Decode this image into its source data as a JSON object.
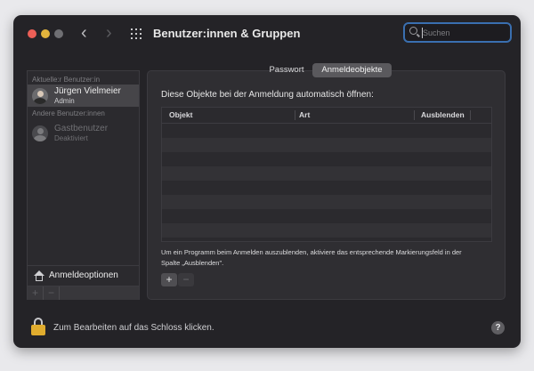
{
  "window": {
    "title": "Benutzer:innen & Gruppen"
  },
  "search": {
    "placeholder": "Suchen"
  },
  "sidebar": {
    "current_section": "Aktuelle:r Benutzer:in",
    "current_user": {
      "name": "Jürgen Vielmeier",
      "role": "Admin"
    },
    "other_section": "Andere Benutzer:innen",
    "other_users": [
      {
        "name": "Gastbenutzer",
        "status": "Deaktiviert"
      }
    ],
    "login_options": "Anmeldeoptionen",
    "add_label": "+",
    "remove_label": "−"
  },
  "tabs": [
    {
      "label": "Passwort",
      "selected": false
    },
    {
      "label": "Anmeldeobjekte",
      "selected": true
    }
  ],
  "main": {
    "heading": "Diese Objekte bei der Anmeldung automatisch öffnen:",
    "columns": [
      "Objekt",
      "Art",
      "Ausblenden"
    ],
    "rows": [],
    "hint": "Um ein Programm beim Anmelden auszublenden, aktiviere das entsprechende Markierungsfeld in der Spalte „Ausblenden\".",
    "add_label": "+",
    "remove_label": "−"
  },
  "footer": {
    "lock_text": "Zum Bearbeiten auf das Schloss klicken.",
    "help_label": "?"
  },
  "icons": {
    "back": "chevron-left-icon",
    "forward": "chevron-right-icon",
    "all_prefs": "grid-icon",
    "search": "search-icon",
    "login_options": "house-icon",
    "lock": "lock-icon",
    "help": "help-icon"
  },
  "colors": {
    "window_bg": "#242327",
    "accent": "#3a6fb0",
    "selected_row": "#464549",
    "lock": "#e0ac2e",
    "close": "#ec5f57",
    "minimize": "#e2b43d"
  }
}
